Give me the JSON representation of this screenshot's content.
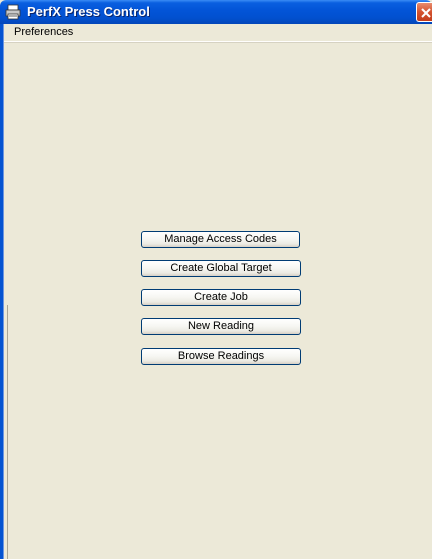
{
  "window": {
    "title": "PerfX Press Control"
  },
  "menu": {
    "items": [
      "Preferences"
    ]
  },
  "actions": {
    "manage_access_codes": "Manage Access Codes",
    "create_global_target": "Create Global Target",
    "create_job": "Create Job",
    "new_reading": "New Reading",
    "browse_readings": "Browse Readings"
  },
  "icons": {
    "app": "printer-press-icon",
    "close": "close-icon"
  },
  "colors": {
    "titlebar": "#0355d8",
    "background": "#ece9d8",
    "close": "#d4532f",
    "button_border": "#003c74"
  }
}
